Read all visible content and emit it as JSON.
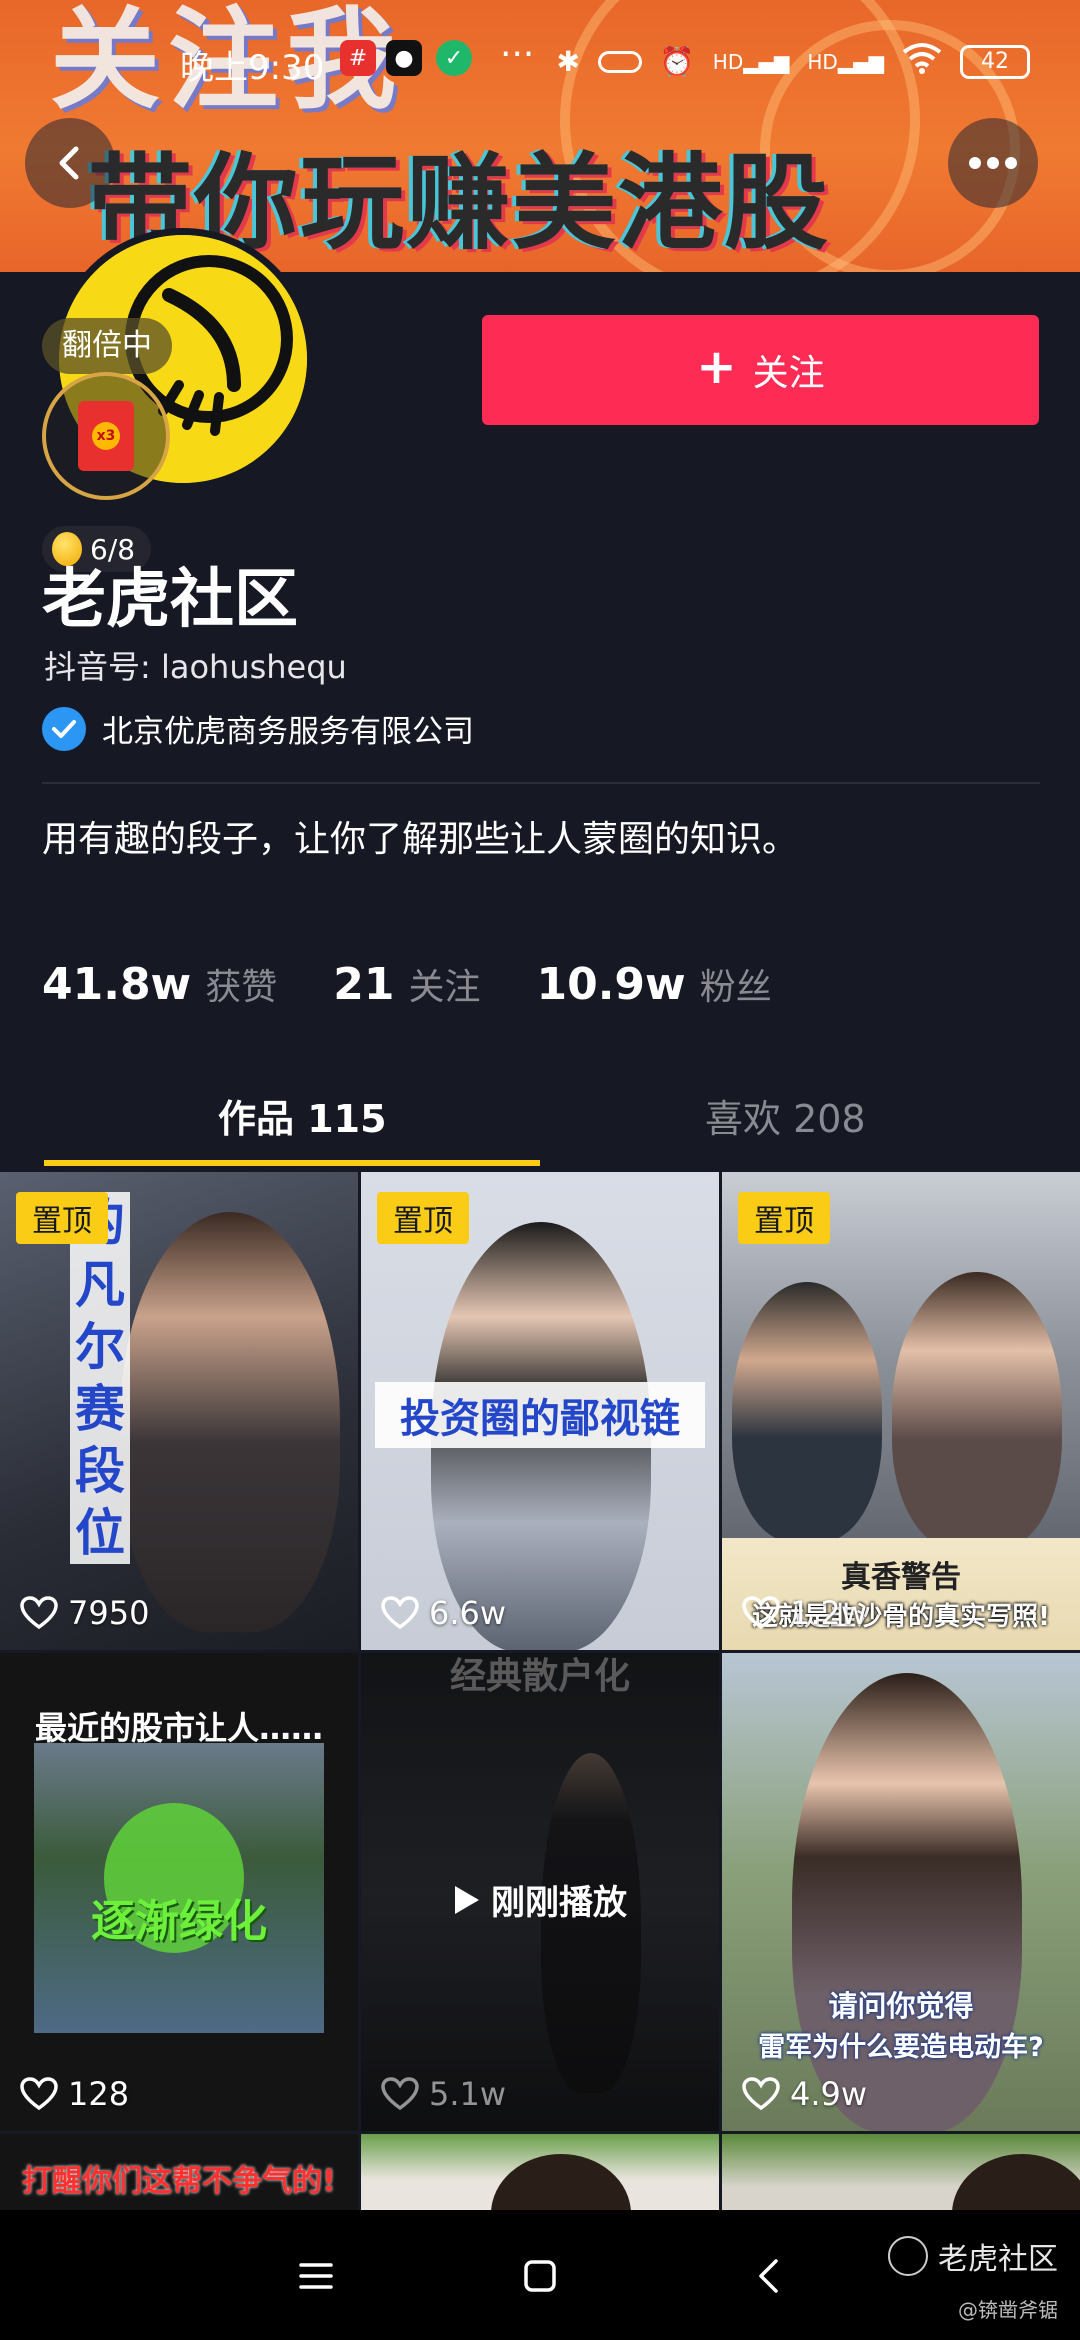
{
  "status_bar": {
    "time": "晚上9:30",
    "battery": "42",
    "icons": [
      "bluetooth-icon",
      "alarm-icon",
      "signal-icon",
      "wifi-icon",
      "battery-icon"
    ],
    "hd1": "HD",
    "hd2": "HD",
    "more": "···"
  },
  "banner": {
    "top_text": "关注我",
    "main_text": "带你玩赚美港股"
  },
  "profile": {
    "badge": "翻倍中",
    "hongbao_multiplier": "x3",
    "progress": "6/8",
    "follow_label": "关注",
    "name": "老虎社区",
    "douyin_id": "抖音号: laohushequ",
    "verified_org": "北京优虎商务服务有限公司",
    "bio": "用有趣的段子，让你了解那些让人蒙圈的知识。"
  },
  "stats": [
    {
      "value": "41.8w",
      "label": "获赞"
    },
    {
      "value": "21",
      "label": "关注"
    },
    {
      "value": "10.9w",
      "label": "粉丝"
    }
  ],
  "tabs": {
    "works": "作品 115",
    "likes": "喜欢 208"
  },
  "videos": [
    {
      "pinned": "置顶",
      "likes": "7950",
      "caption": "的凡尔赛段位"
    },
    {
      "pinned": "置顶",
      "likes": "6.6w",
      "caption": "投资圈的鄙视链"
    },
    {
      "pinned": "置顶",
      "likes": "1.2w",
      "caption1": "真香警告",
      "caption2": "这就是韭沙骨的真实写照!"
    },
    {
      "likes": "128",
      "caption1": "最近的股市让人……",
      "caption2": "逐渐绿化"
    },
    {
      "likes": "5.1w",
      "caption_top": "经典散户化",
      "overlay": "刚刚播放"
    },
    {
      "likes": "4.9w",
      "caption1": "请问你觉得",
      "caption2": "雷军为什么要造电动车?"
    },
    {
      "caption": "打醒你们这帮不争气的!"
    }
  ],
  "watermark": {
    "text": "老虎社区",
    "sub": "@锛凿斧锯"
  },
  "colors": {
    "background": "#161823",
    "follow": "#fe2c55",
    "accent": "#facc15",
    "verify": "#2c96f5"
  }
}
